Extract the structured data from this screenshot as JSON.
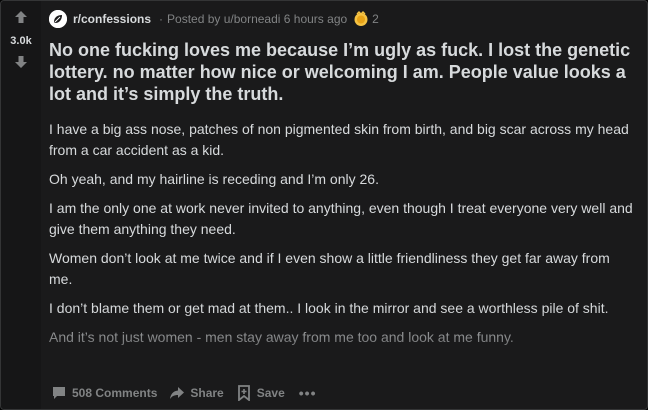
{
  "post": {
    "score": "3.0k",
    "subreddit": "r/confessions",
    "posted_by": "Posted by u/borneadi 6 hours ago",
    "award_count": "2",
    "title": "No one fucking loves me because I’m ugly as fuck. I lost the genetic lottery. no matter how nice or welcoming I am. People value looks a lot and it’s simply the truth.",
    "paragraphs": [
      "I have a big ass nose, patches of non pigmented skin from birth, and big scar across my head from a car accident as a kid.",
      "Oh yeah, and my hairline is receding and I’m only 26.",
      "I am the only one at work never invited to anything, even though I treat everyone very well and give them anything they need.",
      "Women don’t look at me twice and if I even show a little friendliness they get far away from me.",
      "I don’t blame them or get mad at them.. I look in the mirror and see a worthless pile of shit.",
      "And it’s not just women - men stay away from me too and look at me funny."
    ]
  },
  "actions": {
    "comments": "508 Comments",
    "share": "Share",
    "save": "Save",
    "more": "•••"
  },
  "icons": {
    "upvote": "upvote-arrow-icon",
    "downvote": "downvote-arrow-icon",
    "subreddit": "subreddit-icon",
    "award": "award-icon",
    "comments": "comment-icon",
    "share": "share-arrow-icon",
    "save": "bookmark-icon"
  },
  "colors": {
    "card_bg": "#1a1a1b",
    "text": "#d7dadc",
    "meta": "#818384",
    "award": "#f5c242"
  }
}
